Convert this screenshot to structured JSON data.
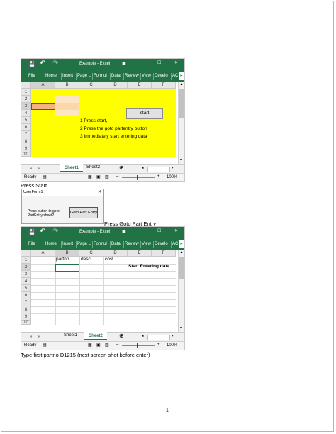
{
  "excel1": {
    "qat": {
      "save": "💾",
      "undo": "↶",
      "redo": "↷"
    },
    "title": "Example - Excel",
    "ribbon_tabs": [
      "File",
      "Home",
      "Insert",
      "Page L",
      "Formul",
      "Data",
      "Review",
      "View",
      "Develo",
      "AC"
    ],
    "columns": [
      "A",
      "B",
      "C",
      "D",
      "E",
      "F"
    ],
    "rows": [
      "1",
      "2",
      "3",
      "4",
      "5",
      "6",
      "7",
      "8",
      "9",
      "10"
    ],
    "start_button": "start",
    "instructions": [
      "1 Press start,",
      "2 Press the goto partentry button",
      "3 Immediately start entering data"
    ],
    "sheet_tabs": [
      "Sheet1",
      "Sheet2"
    ],
    "active_sheet": "Sheet1",
    "status": "Ready",
    "zoom": "100%",
    "fill_color": "#ffff00"
  },
  "caption_press_start": "Press Start",
  "userform": {
    "title": "UserForm1",
    "label": "Press button to  goto PartEntry sheet2",
    "button": "Goto Part Entry"
  },
  "caption_goto": "Press Goto Part Entry",
  "excel2": {
    "title": "Example - Excel",
    "ribbon_tabs": [
      "File",
      "Home",
      "Insert",
      "Page L",
      "Formul",
      "Data",
      "Review",
      "View",
      "Develo",
      "AC"
    ],
    "columns": [
      "A",
      "B",
      "C",
      "D",
      "E",
      "F"
    ],
    "rows": [
      "1",
      "2",
      "3",
      "4",
      "5",
      "6",
      "7",
      "8",
      "9",
      "10"
    ],
    "headers": {
      "b1": "partno",
      "c1": "desc",
      "d1": "cost"
    },
    "e2": "Start Entering data",
    "sheet_tabs": [
      "Sheet1",
      "Sheet2"
    ],
    "active_sheet": "Sheet2",
    "status": "Ready",
    "zoom": "100%"
  },
  "caption_bottom": "Type first partno D1215 (next screen shot before enter)",
  "page_number": "1",
  "colors": {
    "excel_green": "#217346",
    "yellow": "#ffff00",
    "orange": "#f4b183"
  }
}
